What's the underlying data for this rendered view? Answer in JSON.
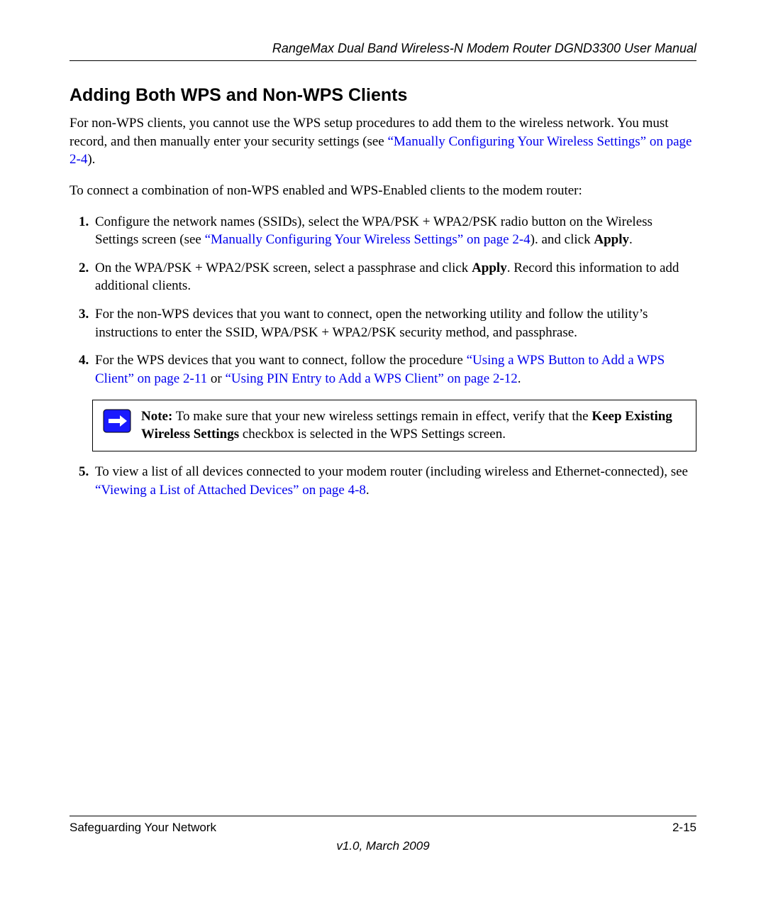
{
  "header": {
    "title": "RangeMax Dual Band Wireless-N Modem Router DGND3300 User Manual"
  },
  "heading": "Adding Both WPS and Non-WPS Clients",
  "intro1_a": "For non-WPS clients, you cannot use the WPS setup procedures to add them to the wireless network. You must record, and then manually enter your security settings (see ",
  "intro1_link": "“Manually Configuring Your Wireless Settings” on page 2-4",
  "intro1_b": ").",
  "intro2": "To connect a combination of non-WPS enabled and WPS-Enabled clients to the modem router:",
  "steps": {
    "s1_a": "Configure the network names (SSIDs), select the WPA/PSK + WPA2/PSK radio button on the Wireless Settings screen (see ",
    "s1_link": "“Manually Configuring Your Wireless Settings” on page 2-4",
    "s1_b": "). and click ",
    "s1_bold": "Apply",
    "s1_c": ".",
    "s2_a": "On the WPA/PSK + WPA2/PSK screen, select a passphrase and click ",
    "s2_bold": "Apply",
    "s2_b": ". Record this information to add additional clients.",
    "s3": "For the non-WPS devices that you want to connect, open the networking utility and follow the utility’s instructions to enter the SSID, WPA/PSK + WPA2/PSK security method, and passphrase.",
    "s4_a": "For the WPS devices that you want to connect, follow the procedure ",
    "s4_link1": "“Using a WPS Button to Add a WPS Client” on page 2-11",
    "s4_b": " or ",
    "s4_link2": "“Using PIN Entry to Add a WPS Client” on page 2-12",
    "s4_c": ".",
    "s5_a": "To view a list of all devices connected to your modem router (including wireless and Ethernet-connected), see ",
    "s5_link": "“Viewing a List of Attached Devices” on page 4-8",
    "s5_b": "."
  },
  "note": {
    "label": "Note:",
    "text_a": " To make sure that your new wireless settings remain in effect, verify that the ",
    "bold": "Keep Existing Wireless Settings",
    "text_b": " checkbox is selected in the WPS Settings screen."
  },
  "footer": {
    "left": "Safeguarding Your Network",
    "right": "2-15",
    "version": "v1.0, March 2009"
  }
}
